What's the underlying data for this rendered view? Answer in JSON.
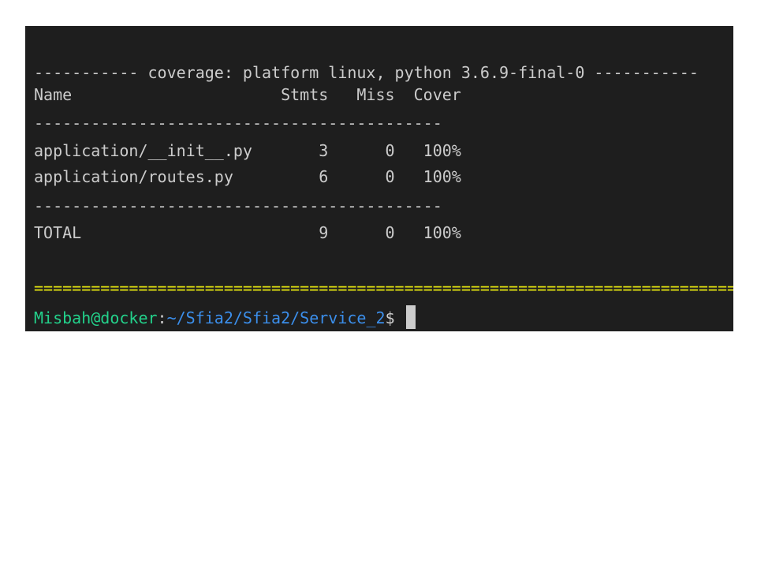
{
  "terminal": {
    "header_line": "----------- coverage: platform linux, python 3.6.9-final-0 -----------",
    "columns_line": "Name                      Stmts   Miss  Cover",
    "separator_top": "-------------------------------------------",
    "rows": [
      {
        "line": "application/__init__.py       3      0   100%"
      },
      {
        "line": "application/routes.py         6      0   100%"
      }
    ],
    "separator_bottom": "-------------------------------------------",
    "total_line": "TOTAL                         9      0   100%",
    "equals_line": "========================================================================================",
    "prompt": {
      "user_host": "Misbah@docker",
      "colon": ":",
      "path": "~/Sfia2/Sfia2/Service_2",
      "symbol": "$ "
    },
    "colors": {
      "background": "#1e1e1e",
      "text": "#cccccc",
      "user_host": "#23d18b",
      "path": "#3b8eea",
      "equals": "#e5e510"
    }
  }
}
